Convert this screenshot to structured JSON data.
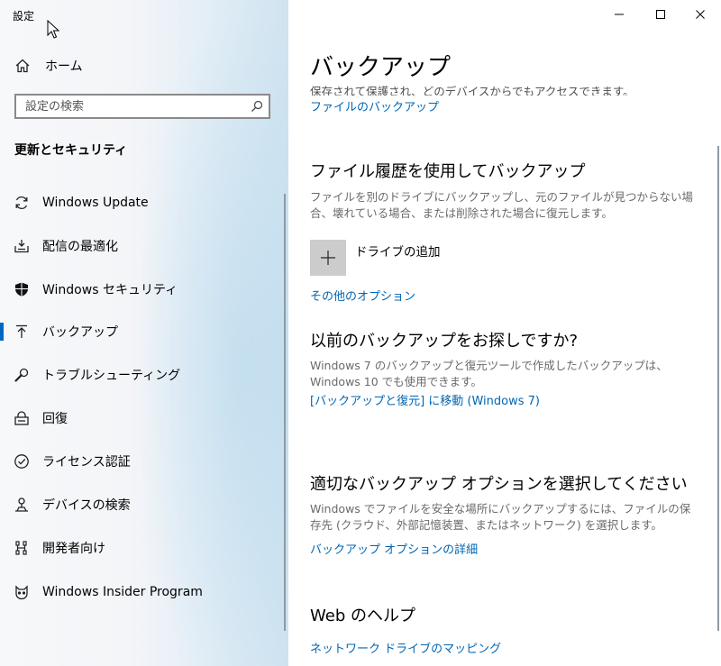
{
  "window": {
    "title": "設定",
    "controls": [
      "minimize",
      "maximize",
      "close"
    ]
  },
  "sidebar": {
    "home_label": "ホーム",
    "search_placeholder": "設定の検索",
    "section_title": "更新とセキュリティ",
    "items": [
      {
        "label": "Windows Update",
        "icon": "sync-icon"
      },
      {
        "label": "配信の最適化",
        "icon": "delivery-optimization-icon"
      },
      {
        "label": "Windows セキュリティ",
        "icon": "shield-icon"
      },
      {
        "label": "バックアップ",
        "icon": "backup-arrow-icon",
        "selected": true
      },
      {
        "label": "トラブルシューティング",
        "icon": "wrench-icon"
      },
      {
        "label": "回復",
        "icon": "recovery-icon"
      },
      {
        "label": "ライセンス認証",
        "icon": "check-circle-icon"
      },
      {
        "label": "デバイスの検索",
        "icon": "find-device-icon"
      },
      {
        "label": "開発者向け",
        "icon": "developer-icon"
      },
      {
        "label": "Windows Insider Program",
        "icon": "insider-cat-icon"
      }
    ]
  },
  "main": {
    "title": "バックアップ",
    "clipped_text": "保存されて保護され、どのデバイスからでもアクセスできます。",
    "onedrive_link": "ファイルのバックアップ",
    "file_history": {
      "heading": "ファイル履歴を使用してバックアップ",
      "description": "ファイルを別のドライブにバックアップし、元のファイルが見つからない場合、壊れている場合、または削除された場合に復元します。",
      "add_drive_label": "ドライブの追加",
      "more_options_link": "その他のオプション"
    },
    "older_backup": {
      "heading": "以前のバックアップをお探しですか?",
      "description": "Windows 7 のバックアップと復元ツールで作成したバックアップは、Windows 10 でも使用できます。",
      "link": "[バックアップと復元] に移動 (Windows 7)"
    },
    "choose_option": {
      "heading": "適切なバックアップ オプションを選択してください",
      "description": "Windows でファイルを安全な場所にバックアップするには、ファイルの保存先 (クラウド、外部記憶装置、またはネットワーク) を選択します。",
      "link": "バックアップ オプションの詳細"
    },
    "web_help": {
      "heading": "Web のヘルプ",
      "link": "ネットワーク ドライブのマッピング"
    }
  },
  "colors": {
    "accent": "#0067c0",
    "link": "#0066b4",
    "tile": "#cccccc"
  }
}
